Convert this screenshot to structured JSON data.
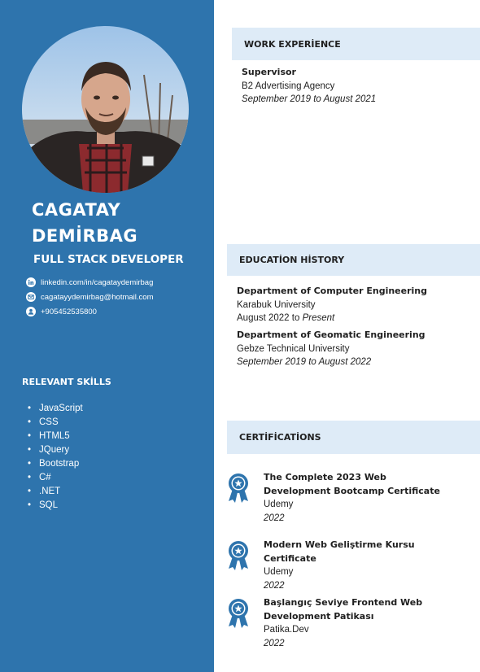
{
  "profile": {
    "first_name": "CAGATAY",
    "last_name": "DEMİRBAG",
    "title": "FULL STACK DEVELOPER",
    "contacts": [
      {
        "icon": "linkedin-icon",
        "text": "linkedin.com/in/cagataydemirbag"
      },
      {
        "icon": "email-icon",
        "text": "cagatayydemirbag@hotmail.com"
      },
      {
        "icon": "phone-icon",
        "text": "+905452535800"
      }
    ]
  },
  "skills": {
    "title": "RELEVANT SKİLLS",
    "items": [
      "JavaScript",
      "CSS",
      "HTML5",
      "JQuery",
      "Bootstrap",
      "C#",
      ".NET",
      "SQL"
    ]
  },
  "work": {
    "title": "WORK EXPERİENCE",
    "items": [
      {
        "role": "Supervisor",
        "company": "B2 Advertising Agency",
        "dates": "September 2019 to August 2021"
      }
    ]
  },
  "education": {
    "title": "EDUCATİON HİSTORY",
    "items": [
      {
        "degree": "Department of Computer Engineering",
        "school": "Karabuk University",
        "start": "August 2022",
        "sep": " to ",
        "end": "Present"
      },
      {
        "degree": "Department of Geomatic Engineering",
        "school": "Gebze Technical University",
        "dates": "September 2019 to August 2022"
      }
    ]
  },
  "certifications": {
    "title": "CERTİFİCATİONS",
    "items": [
      {
        "line1": "The Complete 2023 Web",
        "line2": "Development Bootcamp Certificate",
        "issuer": "Udemy",
        "year": "2022"
      },
      {
        "line1": "Modern Web Geliştirme Kursu",
        "line2": "Certificate",
        "issuer": "Udemy",
        "year": "2022"
      },
      {
        "line1": "Başlangıç Seviye Frontend Web",
        "line2": "Development Patikası",
        "issuer": "Patika.Dev",
        "year": "2022"
      }
    ]
  },
  "colors": {
    "sidebar": "#2e74ad",
    "section_header": "#deebf7",
    "medal": "#2e74ad"
  }
}
